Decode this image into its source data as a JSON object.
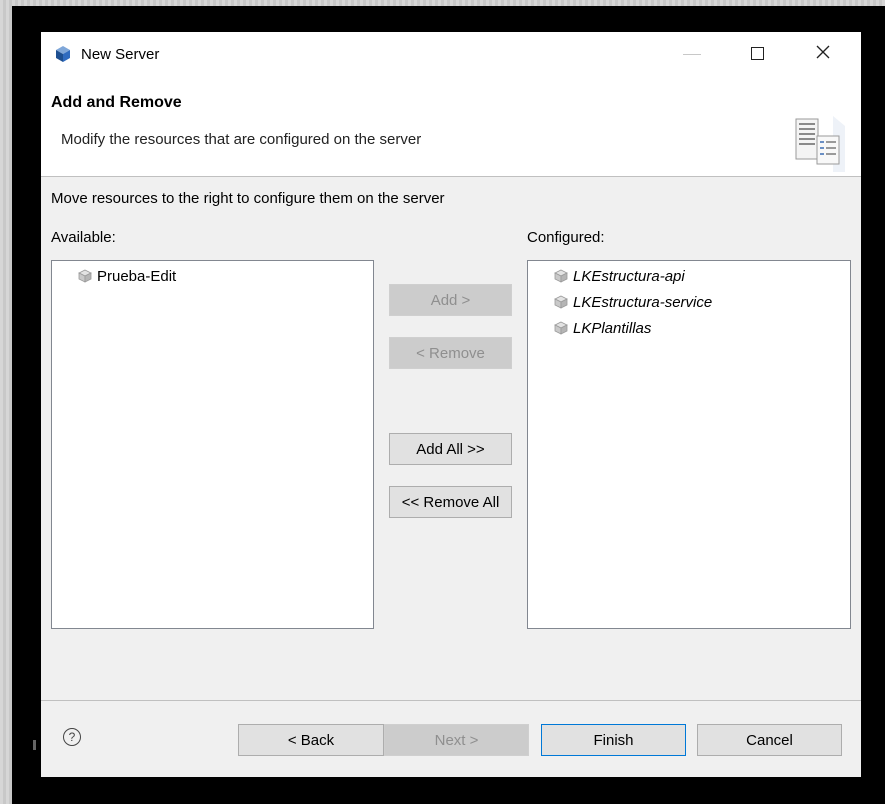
{
  "window": {
    "title": "New Server",
    "icon": "server-cube-icon"
  },
  "banner": {
    "title": "Add and Remove",
    "subtitle": "Modify the resources that are configured on the server",
    "icon": "server-wizard-illustration"
  },
  "instruction": "Move resources to the right to configure them on the server",
  "available": {
    "label": "Available:",
    "items": [
      {
        "label": "Prueba-Edit",
        "icon": "project-icon"
      }
    ]
  },
  "configured": {
    "label": "Configured:",
    "items": [
      {
        "label": "LKEstructura-api",
        "icon": "project-icon"
      },
      {
        "label": "LKEstructura-service",
        "icon": "project-icon"
      },
      {
        "label": "LKPlantillas",
        "icon": "project-icon"
      }
    ]
  },
  "middle_buttons": {
    "add": "Add >",
    "remove": "< Remove",
    "add_all": "Add All >>",
    "remove_all": "<< Remove All"
  },
  "footer": {
    "help": "?",
    "back": "< Back",
    "next": "Next >",
    "finish": "Finish",
    "cancel": "Cancel"
  },
  "colors": {
    "dialog_bg": "#f0f0f0",
    "accent": "#0078d7",
    "frame": "#000000"
  }
}
